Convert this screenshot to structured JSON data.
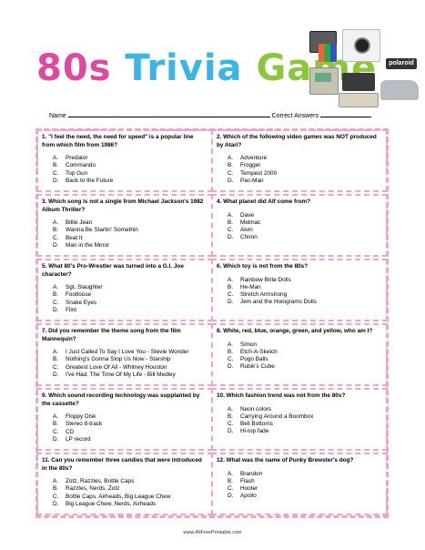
{
  "title": {
    "w1": "80s",
    "w2": "Trivia",
    "w3": "Game"
  },
  "name_label": "Name",
  "correct_label": "Correct Answers",
  "questions": [
    {
      "q": "1. \"I feel the need, the need for speed\" is a popular line from which film from 1986?",
      "opts": [
        [
          "A.",
          "Predator"
        ],
        [
          "B.",
          "Commando"
        ],
        [
          "C.",
          "Top Gun"
        ],
        [
          "D.",
          "Back to the Future"
        ]
      ]
    },
    {
      "q": "2. Which of the following video games was NOT produced by Atari?",
      "opts": [
        [
          "A.",
          "Adventure"
        ],
        [
          "B.",
          "Frogger"
        ],
        [
          "C.",
          "Tempest 2000"
        ],
        [
          "D.",
          "Pac-Man"
        ]
      ]
    },
    {
      "q": "3. Which song is not a single from Michael Jackson's 1982 Album Thriller?",
      "opts": [
        [
          "A.",
          "Billie Jean"
        ],
        [
          "B.",
          "Wanna Be Startin' Somethin"
        ],
        [
          "C.",
          "Beat It"
        ],
        [
          "D.",
          "Man in the Mirror"
        ]
      ]
    },
    {
      "q": "4. What planet did Alf come from?",
      "opts": [
        [
          "A.",
          "Dave"
        ],
        [
          "B.",
          "Melmac"
        ],
        [
          "C.",
          "Alvin"
        ],
        [
          "D.",
          "Chiron"
        ]
      ]
    },
    {
      "q": "5. What 80's Pro-Wrestler was turned into a G.I. Joe character?",
      "opts": [
        [
          "A.",
          "Sgt. Slaughter"
        ],
        [
          "B.",
          "Footloose"
        ],
        [
          "C.",
          "Snake Eyes"
        ],
        [
          "D.",
          "Flint"
        ]
      ]
    },
    {
      "q": "6. Which toy is not from the 80s?",
      "opts": [
        [
          "A.",
          "Rainbow Brite Dolls"
        ],
        [
          "B.",
          "He-Man"
        ],
        [
          "C.",
          "Stretch Armstrong"
        ],
        [
          "D.",
          "Jem and the Holograms Dolls"
        ]
      ]
    },
    {
      "q": "7. Did you remember the theme song from the film Mannequin?",
      "opts": [
        [
          "A.",
          "I Just Called To Say I Love You - Stevie Wonder"
        ],
        [
          "B.",
          "Nothing's Gonna Stop Us Now - Starship"
        ],
        [
          "C.",
          "Greatest Love Of All - Whitney Houston"
        ],
        [
          "D.",
          "I've Had, The Time Of My Life - Bill Medley"
        ]
      ]
    },
    {
      "q": "8. White, red, blue, orange, green, and yellow, who am I?",
      "opts": [
        [
          "A.",
          "Simon"
        ],
        [
          "B.",
          "Etch-A-Sketch"
        ],
        [
          "C.",
          "Pogo Balls"
        ],
        [
          "D.",
          "Rubik's Cube"
        ]
      ]
    },
    {
      "q": "9. Which sound recording technology was supplanted by the cassette?",
      "opts": [
        [
          "A.",
          "Floppy Disk"
        ],
        [
          "B.",
          "Stereo 8-track"
        ],
        [
          "C.",
          "CD"
        ],
        [
          "D.",
          "LP record"
        ]
      ]
    },
    {
      "q": "10. Which fashion trend was not from the 80s?",
      "opts": [
        [
          "A.",
          "Neon colors"
        ],
        [
          "B.",
          "Carrying Around a Boombox"
        ],
        [
          "C.",
          "Bell Bottoms"
        ],
        [
          "D.",
          "Hi-top fade"
        ]
      ]
    },
    {
      "q": "11. Can you remember three candies that were introduced in the 80s?",
      "opts": [
        [
          "A.",
          "Zotz, Razzles, Bottle Caps"
        ],
        [
          "B.",
          "Razzles, Nerds, Zotz"
        ],
        [
          "C.",
          "Bottle Caps, Airheads, Big League Chew"
        ],
        [
          "D.",
          "Big League Chew, Nerds, Airheads"
        ]
      ]
    },
    {
      "q": "12. What was the name of Punky Brewster's dog?",
      "opts": [
        [
          "A.",
          "Brandon"
        ],
        [
          "B.",
          "Flash"
        ],
        [
          "C.",
          "Hooter"
        ],
        [
          "D.",
          "Apollo"
        ]
      ]
    }
  ],
  "collage": {
    "label": "polaroid"
  },
  "footer": "www.AllFreePrintable.com"
}
